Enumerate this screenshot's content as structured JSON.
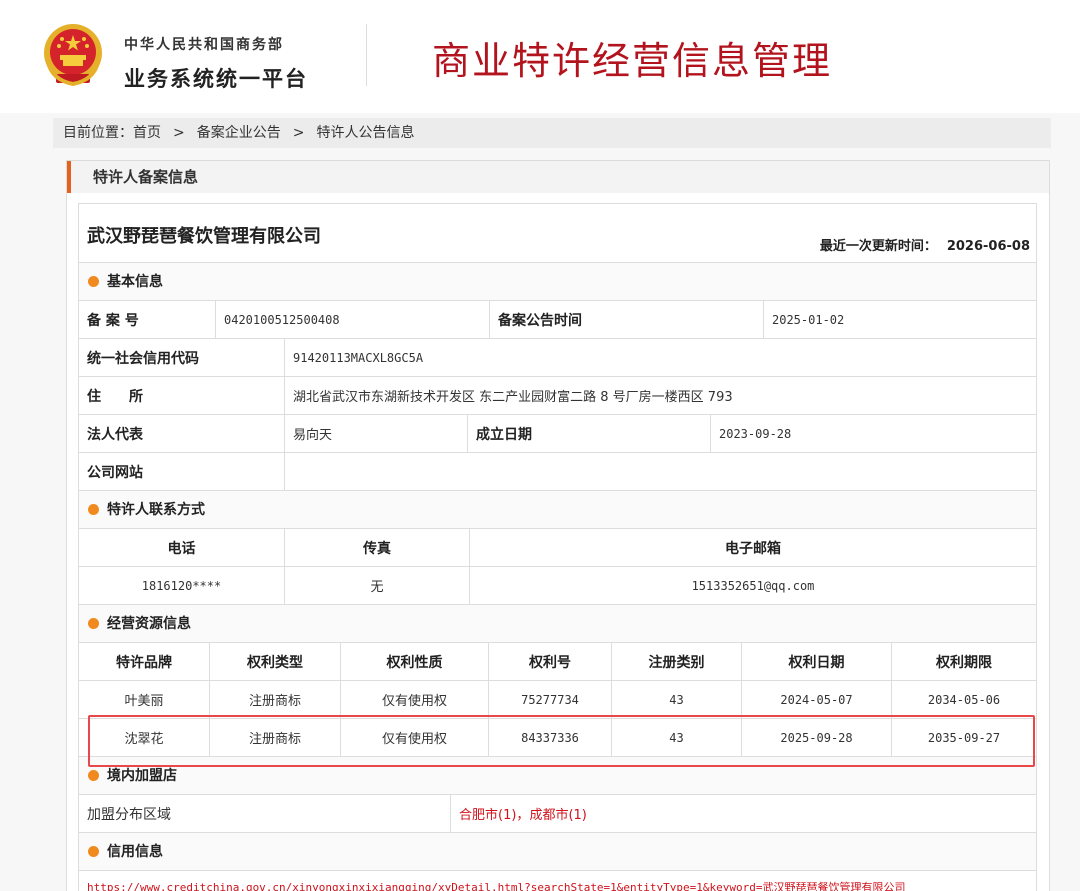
{
  "header": {
    "org_line1": "中华人民共和国商务部",
    "org_line2": "业务系统统一平台",
    "system_title": "商业特许经营信息管理"
  },
  "breadcrumb": {
    "prefix": "目前位置：",
    "items": [
      "首页",
      "备案企业公告",
      "特许人公告信息"
    ],
    "separator": ">"
  },
  "panel_title": "特许人备案信息",
  "company": {
    "name": "武汉野琵琶餐饮管理有限公司",
    "updated_label": "最近一次更新时间：",
    "updated_value": "2026-06-08"
  },
  "basic": {
    "section_title": "基本信息",
    "filing_no_label": "备 案 号",
    "filing_no": "0420100512500408",
    "announce_label": "备案公告时间",
    "announce_date": "2025-01-02",
    "credit_code_label": "统一社会信用代码",
    "credit_code": "91420113MACXL8GC5A",
    "address_label": "住　　所",
    "address": "湖北省武汉市东湖新技术开发区 东二产业园财富二路 8 号厂房一楼西区 793",
    "legal_rep_label": "法人代表",
    "legal_rep": "易向天",
    "est_date_label": "成立日期",
    "est_date": "2023-09-28",
    "website_label": "公司网站",
    "website": ""
  },
  "contact": {
    "section_title": "特许人联系方式",
    "headers": [
      "电话",
      "传真",
      "电子邮箱"
    ],
    "phone": "1816120****",
    "fax": "无",
    "email": "1513352651@qq.com"
  },
  "resources": {
    "section_title": "经营资源信息",
    "headers": [
      "特许品牌",
      "权利类型",
      "权利性质",
      "权利号",
      "注册类别",
      "权利日期",
      "权利期限"
    ],
    "rows": [
      [
        "叶美丽",
        "注册商标",
        "仅有使用权",
        "75277734",
        "43",
        "2024-05-07",
        "2034-05-06"
      ],
      [
        "沈翠花",
        "注册商标",
        "仅有使用权",
        "84337336",
        "43",
        "2025-09-28",
        "2035-09-27"
      ]
    ]
  },
  "franchise": {
    "section_title": "境内加盟店",
    "region_label": "加盟分布区域",
    "city1": "合肥市(1)",
    "comma": "，",
    "city2": "成都市(1)"
  },
  "credit": {
    "section_title": "信用信息",
    "url": "https://www.creditchina.gov.cn/xinyongxinxixiangqing/xyDetail.html?searchState=1&entityType=1&keyword=武汉野琵琶餐饮管理有限公司"
  },
  "colors": {
    "accent_red": "#b3131d",
    "accent_orange": "#e2631e",
    "dot_orange": "#f08a1e",
    "highlight_red": "#e8474c"
  }
}
